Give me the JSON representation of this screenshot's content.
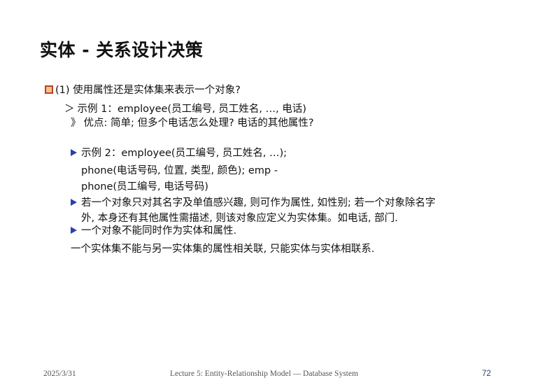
{
  "slide": {
    "title": "实体 - 关系设计决策",
    "q1": "(1) 使用属性还是实体集来表示一个对象?",
    "ex1_marker": "＞",
    "ex1": "示例 1：employee(员工编号, 员工姓名, …, 电话)",
    "ex1_sub_marker": "》",
    "ex1_sub": "优点: 简单; 但多个电话怎么处理? 电话的其他属性?",
    "ex2_line1": "示例 2：employee(员工编号, 员工姓名, …);",
    "ex2_line2": "phone(电话号码, 位置, 类型, 颜色); emp -",
    "ex2_line3": "phone(员工编号, 电话号码)",
    "rule1_line1": "若一个对象只对其名字及单值感兴趣, 则可作为属性, 如性别; 若一个对象除名字",
    "rule1_line2": "外, 本身还有其他属性需描述, 则该对象应定义为实体集。如电话, 部门.",
    "rule2": "一个对象不能同时作为实体和属性.",
    "rule3": "一个实体集不能与另一实体集的属性相关联, 只能实体与实体相联系."
  },
  "footer": {
    "date": "2025/3/31",
    "lecture": "Lecture 5: Entity-Relationship Model — Database System",
    "page": "72"
  },
  "colors": {
    "bullet_box": "#c0401f",
    "bullet_triangle": "#2b3fae"
  }
}
